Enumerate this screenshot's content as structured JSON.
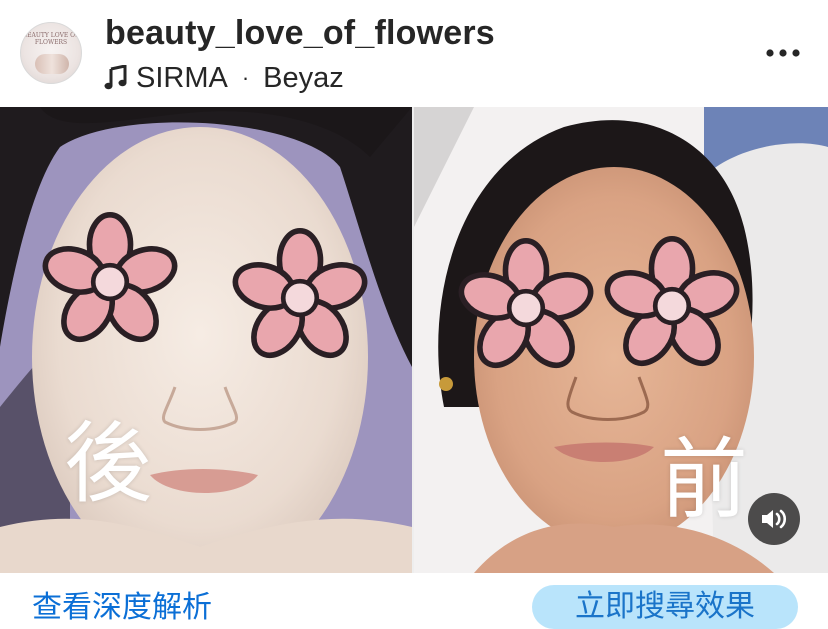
{
  "post": {
    "username": "beauty_love_of_flowers",
    "avatar_text": "BEAUTY LOVE OF FLOWERS",
    "music": {
      "artist": "SIRMA",
      "separator": "·",
      "track": "Beyaz"
    }
  },
  "media": {
    "after_label": "後",
    "before_label": "前"
  },
  "footer": {
    "link_text": "查看深度解析",
    "pill_text": "立即搜尋效果"
  },
  "icons": {
    "music": "music-note-icon",
    "more": "more-options-icon",
    "sound": "speaker-icon",
    "flower": "flower-sticker"
  },
  "colors": {
    "flower_fill": "#e9a6ad",
    "flower_center": "#f4d9dc",
    "flower_outline": "#2a1f24",
    "link_blue": "#0b6fd6",
    "pill_bg": "#b9e4fb"
  }
}
